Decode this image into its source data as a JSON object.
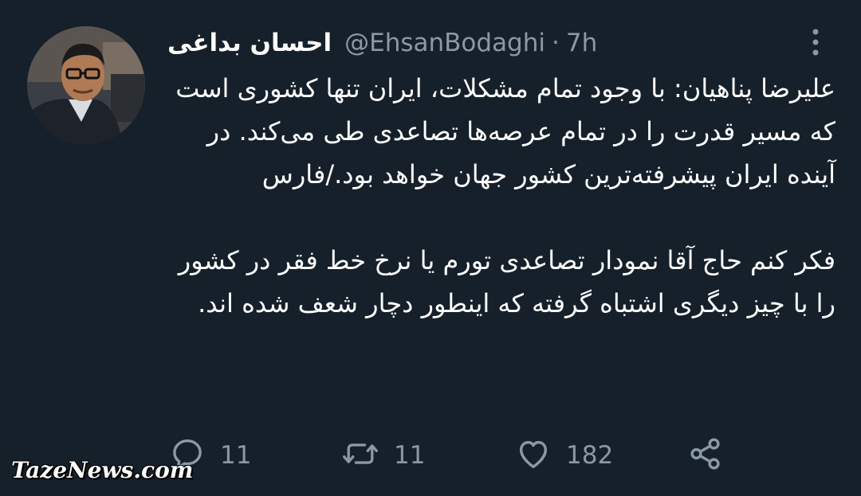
{
  "author": {
    "display_name": "احسان بداغی",
    "handle": "@EhsanBodaghi",
    "separator": "·",
    "time": "7h"
  },
  "tweet": {
    "paragraphs": [
      "علیرضا پناهیان: با وجود تمام مشکلات، ایران تنها کشوری است که مسیر قدرت را در تمام عرصه‌ها تصاعدی طی می‌کند. در آینده ایران پیشرفته‌ترین کشور جهان خواهد بود./فارس",
      "فکر کنم حاج آقا نمودار تصاعدی تورم یا نرخ خط فقر در کشور را با چیز دیگری اشتباه گرفته که اینطور دچار شعف شده اند."
    ]
  },
  "actions": {
    "reply_count": "11",
    "retweet_count": "11",
    "like_count": "182"
  },
  "watermark": "TazeNews.com",
  "icons": {
    "more": "more-vertical-icon",
    "reply": "reply-icon",
    "retweet": "retweet-icon",
    "like": "like-icon",
    "share": "share-icon"
  },
  "colors": {
    "background": "#15202b",
    "text": "#ffffff",
    "secondary": "#8b98a5"
  }
}
